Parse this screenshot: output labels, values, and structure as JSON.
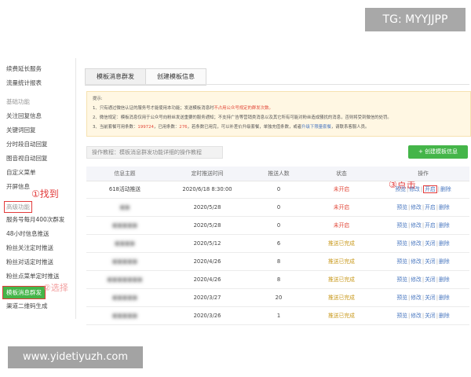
{
  "watermark_top": "TG: MYYJJPP",
  "watermark_bottom": "www.yidetiyuzh.com",
  "sidebar": {
    "items": [
      {
        "label": "续费延长服务",
        "type": "item"
      },
      {
        "label": "流量统计报表",
        "type": "item"
      },
      {
        "label": "基础功能",
        "type": "group"
      },
      {
        "label": "关注回复信息",
        "type": "item"
      },
      {
        "label": "关键词回复",
        "type": "item"
      },
      {
        "label": "分时段自动回复",
        "type": "item"
      },
      {
        "label": "图音视自动回复",
        "type": "item"
      },
      {
        "label": "自定义菜单",
        "type": "item"
      },
      {
        "label": "开屏信息",
        "type": "item"
      },
      {
        "label": "高级功能",
        "type": "group-highlight"
      },
      {
        "label": "服务号每月400次群发",
        "type": "item"
      },
      {
        "label": "48小时信息推送",
        "type": "item"
      },
      {
        "label": "粉丝关注定时推送",
        "type": "item"
      },
      {
        "label": "粉丝对话定时推送",
        "type": "item"
      },
      {
        "label": "粉丝点菜单定时推送",
        "type": "item"
      },
      {
        "label": "模板消息群发",
        "type": "active"
      },
      {
        "label": "渠道二维码生成",
        "type": "item"
      }
    ]
  },
  "annotations": {
    "step1": "①找到",
    "step2": "②选择",
    "step3": "③点击"
  },
  "tabs": [
    {
      "label": "模板消息群发",
      "active": true
    },
    {
      "label": "创建模板信息",
      "active": false
    }
  ],
  "notice": {
    "title": "提示:",
    "line1_a": "1、只有通过微信认证的服务号才能使用本功能；发送模板消息时",
    "line1_red": "不占用公众号规定的群发次数。",
    "line2": "2、微信规定：模板消息仅用于公众号向粉丝发送重要的服务通知；不支持广告等营销类消息以及其它所有可能对粉丝造成骚扰的消息，否则将受到微信的处罚。",
    "line3_a": "3、当前套餐可用条数：",
    "line3_num1": "199724",
    "line3_b": "，已用条数：",
    "line3_num2": "276",
    "line3_c": "，若条数已用完，可以补差价升级套餐，单独充值条数，或者",
    "line3_link": "升级下限量套餐",
    "line3_d": "，请联系客服人员。"
  },
  "tutorial_text": "操作教程：模板消息群发功能详细的操作教程",
  "create_button": "+ 创建模板信息",
  "table": {
    "headers": [
      "信息主题",
      "定时推送时间",
      "推送人数",
      "状态",
      "操作"
    ],
    "rows": [
      {
        "topic": "618活动推送",
        "blur": false,
        "time": "2020/6/18 8:30:00",
        "count": "0",
        "status": "未开启",
        "status_type": "off",
        "toggle": "开启",
        "boxed": true
      },
      {
        "topic": "■■",
        "blur": true,
        "time": "2020/5/28",
        "count": "0",
        "status": "未开启",
        "status_type": "off",
        "toggle": "开启",
        "boxed": false
      },
      {
        "topic": "■■■■■",
        "blur": true,
        "time": "2020/5/28",
        "count": "0",
        "status": "未开启",
        "status_type": "off",
        "toggle": "开启",
        "boxed": false
      },
      {
        "topic": "■■■■",
        "blur": true,
        "time": "2020/5/12",
        "count": "6",
        "status": "推送已完成",
        "status_type": "done",
        "toggle": "关闭",
        "boxed": false
      },
      {
        "topic": "■■■■■",
        "blur": true,
        "time": "2020/4/26",
        "count": "8",
        "status": "推送已完成",
        "status_type": "done",
        "toggle": "关闭",
        "boxed": false
      },
      {
        "topic": "■■■■■■■",
        "blur": true,
        "time": "2020/4/26",
        "count": "8",
        "status": "推送已完成",
        "status_type": "done",
        "toggle": "关闭",
        "boxed": false
      },
      {
        "topic": "■■■■■",
        "blur": true,
        "time": "2020/3/27",
        "count": "20",
        "status": "推送已完成",
        "status_type": "done",
        "toggle": "关闭",
        "boxed": false
      },
      {
        "topic": "■■■■■",
        "blur": true,
        "time": "2020/3/26",
        "count": "1",
        "status": "推送已完成",
        "status_type": "done",
        "toggle": "关闭",
        "boxed": false
      }
    ],
    "op_preview": "预览",
    "op_edit": "修改",
    "op_delete": "删除"
  }
}
